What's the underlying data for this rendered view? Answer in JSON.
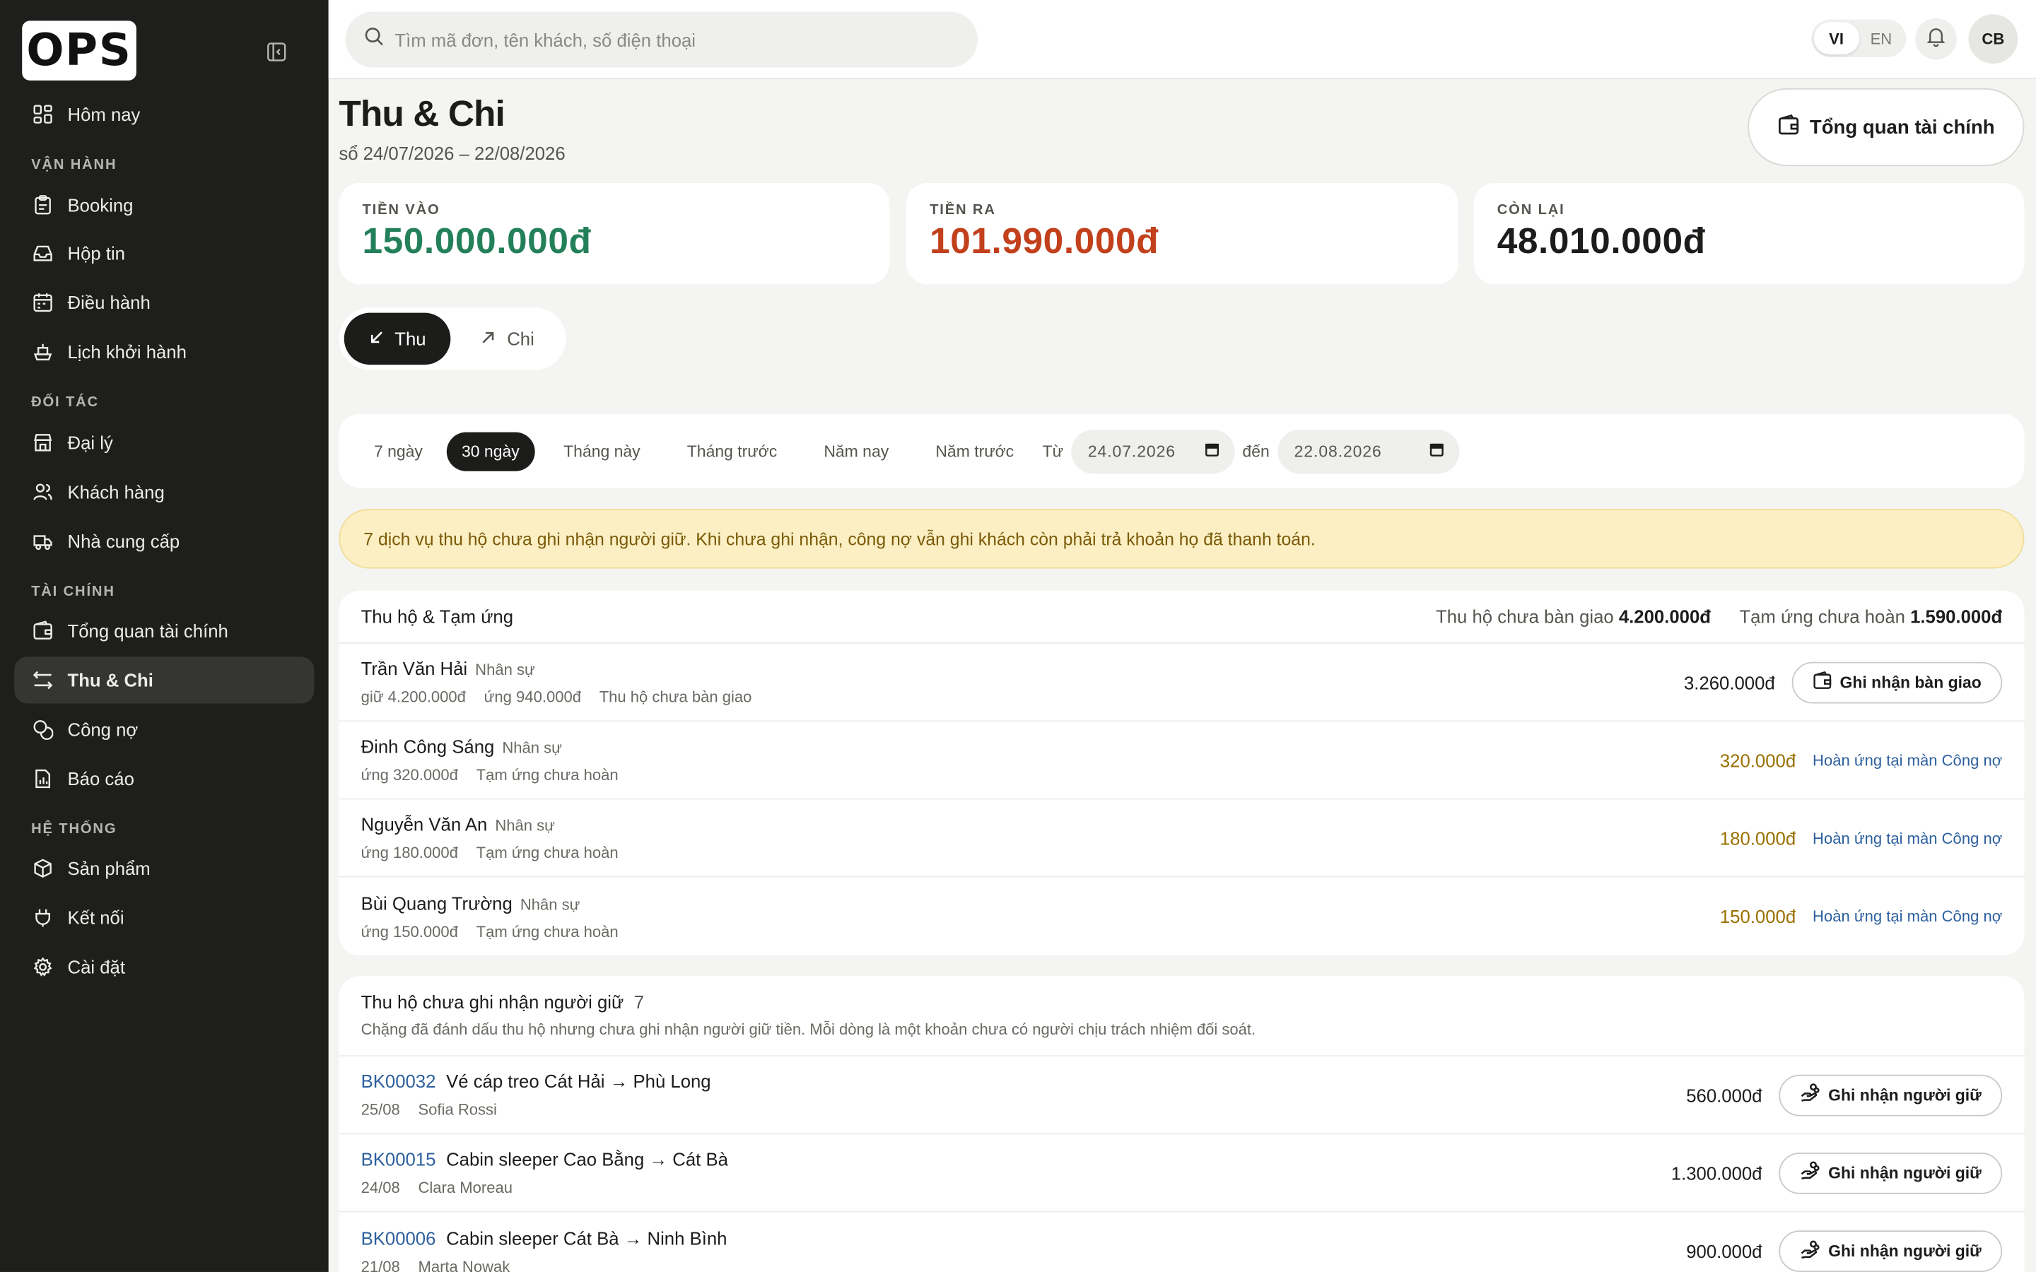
{
  "sidebar": {
    "logo": "OPS",
    "items": {
      "today": "Hôm nay",
      "booking": "Booking",
      "inbox": "Hộp tin",
      "dispatch": "Điều hành",
      "schedule": "Lịch khởi hành",
      "agents": "Đại lý",
      "customers": "Khách hàng",
      "suppliers": "Nhà cung cấp",
      "finance_overview": "Tổng quan tài chính",
      "income_expense": "Thu & Chi",
      "debt": "Công nợ",
      "reports": "Báo cáo",
      "products": "Sản phẩm",
      "connections": "Kết nối",
      "settings": "Cài đặt"
    },
    "sections": {
      "operations": "VẬN HÀNH",
      "partners": "ĐỐI TÁC",
      "finance": "TÀI CHÍNH",
      "system": "HỆ THỐNG"
    }
  },
  "topbar": {
    "search_placeholder": "Tìm mã đơn, tên khách, số điện thoại",
    "lang_vi": "VI",
    "lang_en": "EN",
    "avatar": "CB"
  },
  "header": {
    "title": "Thu & Chi",
    "subtitle": "sổ 24/07/2026 – 22/08/2026",
    "overview_button": "Tổng quan tài chính"
  },
  "stats": {
    "in_label": "TIỀN VÀO",
    "in_value": "150.000.000đ",
    "out_label": "TIỀN RA",
    "out_value": "101.990.000đ",
    "left_label": "CÒN LẠI",
    "left_value": "48.010.000đ"
  },
  "colors": {
    "income": "#23805a",
    "expense": "#c2401c",
    "pending": "#9a7000",
    "link": "#2d5f9e"
  },
  "segment": {
    "in": "Thu",
    "out": "Chi"
  },
  "filters": {
    "chips": [
      "7 ngày",
      "30 ngày",
      "Tháng này",
      "Tháng trước",
      "Năm nay",
      "Năm trước"
    ],
    "from_label": "Từ",
    "from_value": "24.07.2026",
    "to_label": "đến",
    "to_value": "22.08.2026"
  },
  "warning": "7 dịch vụ thu hộ chưa ghi nhận người giữ. Khi chưa ghi nhận, công nợ vẫn ghi khách còn phải trả khoản họ đã thanh toán.",
  "custody": {
    "title": "Thu hộ & Tạm ứng",
    "summary_label_1": "Thu hộ chưa bàn giao",
    "summary_value_1": "4.200.000đ",
    "summary_label_2": "Tạm ứng chưa hoàn",
    "summary_value_2": "1.590.000đ",
    "rows": [
      {
        "name": "Trần Văn Hải",
        "role": "Nhân sự",
        "meta1": "giữ 4.200.000đ",
        "meta2": "ứng 940.000đ",
        "meta3": "Thu hộ chưa bàn giao",
        "amount": "3.260.000đ",
        "action": "Ghi nhận bàn giao"
      },
      {
        "name": "Đinh Công Sáng",
        "role": "Nhân sự",
        "meta1": "ứng 320.000đ",
        "meta2": "Tạm ứng chưa hoàn",
        "amount": "320.000đ",
        "action": "Hoàn ứng tại màn Công nợ"
      },
      {
        "name": "Nguyễn Văn An",
        "role": "Nhân sự",
        "meta1": "ứng 180.000đ",
        "meta2": "Tạm ứng chưa hoàn",
        "amount": "180.000đ",
        "action": "Hoàn ứng tại màn Công nợ"
      },
      {
        "name": "Bùi Quang Trường",
        "role": "Nhân sự",
        "meta1": "ứng 150.000đ",
        "meta2": "Tạm ứng chưa hoàn",
        "amount": "150.000đ",
        "action": "Hoàn ứng tại màn Công nợ"
      }
    ]
  },
  "unassigned": {
    "title": "Thu hộ chưa ghi nhận người giữ",
    "count": "7",
    "description": "Chặng đã đánh dấu thu hộ nhưng chưa ghi nhận người giữ tiền. Mỗi dòng là một khoản chưa có người chịu trách nhiệm đối soát.",
    "action": "Ghi nhận người giữ",
    "rows": [
      {
        "code": "BK00032",
        "title": "Vé cáp treo Cát Hải → Phù Long",
        "date": "25/08",
        "customer": "Sofia Rossi",
        "amount": "560.000đ"
      },
      {
        "code": "BK00015",
        "title": "Cabin sleeper Cao Bằng → Cát Bà",
        "date": "24/08",
        "customer": "Clara Moreau",
        "amount": "1.300.000đ"
      },
      {
        "code": "BK00006",
        "title": "Cabin sleeper Cát Bà → Ninh Bình",
        "date": "21/08",
        "customer": "Marta Nowak",
        "amount": "900.000đ"
      }
    ]
  }
}
